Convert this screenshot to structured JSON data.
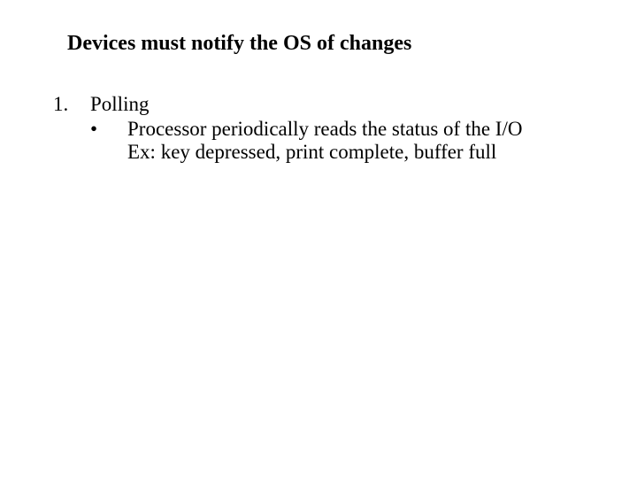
{
  "title": "Devices must notify the OS of changes",
  "list": {
    "item1": {
      "number": "1.",
      "label": "Polling",
      "sub": {
        "bullet": "•",
        "line1": "Processor periodically reads the status of the I/O",
        "line2": "Ex: key depressed, print complete, buffer full"
      }
    }
  }
}
